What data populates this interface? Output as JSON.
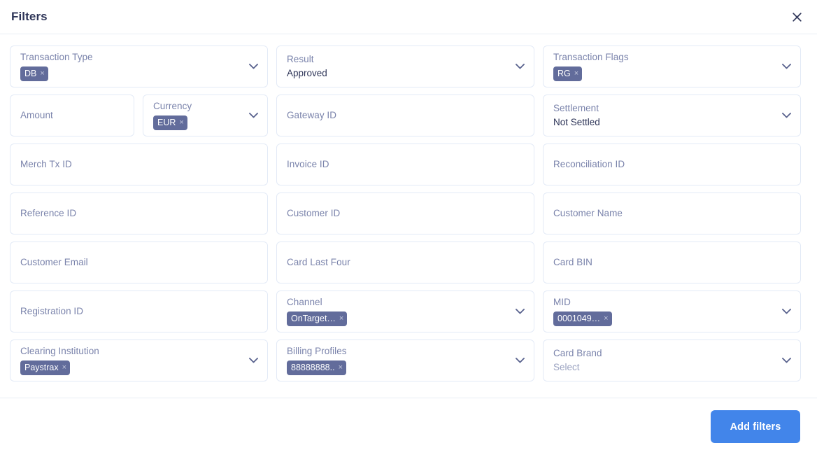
{
  "header": {
    "title": "Filters",
    "close_icon": "close-icon"
  },
  "icons": {
    "chevron": "chevron-down-icon",
    "chip_remove": "×"
  },
  "fields": [
    {
      "key": "transaction_type",
      "label": "Transaction Type",
      "type": "multiselect",
      "width": "full",
      "chips": [
        {
          "text": "DB"
        }
      ]
    },
    {
      "key": "result",
      "label": "Result",
      "type": "select",
      "width": "full",
      "value": "Approved"
    },
    {
      "key": "transaction_flags",
      "label": "Transaction Flags",
      "type": "multiselect",
      "width": "full",
      "chips": [
        {
          "text": "RG"
        }
      ]
    },
    {
      "key": "amount",
      "label": "Amount",
      "type": "text",
      "width": "narrow"
    },
    {
      "key": "currency",
      "label": "Currency",
      "type": "multiselect",
      "width": "narrow2",
      "chips": [
        {
          "text": "EUR"
        }
      ]
    },
    {
      "key": "gateway_id",
      "label": "Gateway ID",
      "type": "text",
      "width": "full"
    },
    {
      "key": "settlement",
      "label": "Settlement",
      "type": "select",
      "width": "full",
      "value": "Not Settled"
    },
    {
      "key": "merch_tx_id",
      "label": "Merch Tx ID",
      "type": "text",
      "width": "full"
    },
    {
      "key": "invoice_id",
      "label": "Invoice ID",
      "type": "text",
      "width": "full"
    },
    {
      "key": "reconciliation_id",
      "label": "Reconciliation ID",
      "type": "text",
      "width": "full"
    },
    {
      "key": "reference_id",
      "label": "Reference ID",
      "type": "text",
      "width": "full"
    },
    {
      "key": "customer_id",
      "label": "Customer ID",
      "type": "text",
      "width": "full"
    },
    {
      "key": "customer_name",
      "label": "Customer Name",
      "type": "text",
      "width": "full"
    },
    {
      "key": "customer_email",
      "label": "Customer Email",
      "type": "text",
      "width": "full"
    },
    {
      "key": "card_last_four",
      "label": "Card Last Four",
      "type": "text",
      "width": "full"
    },
    {
      "key": "card_bin",
      "label": "Card BIN",
      "type": "text",
      "width": "full"
    },
    {
      "key": "registration_id",
      "label": "Registration ID",
      "type": "text",
      "width": "full"
    },
    {
      "key": "channel",
      "label": "Channel",
      "type": "multiselect",
      "width": "full",
      "chips": [
        {
          "text": "OnTarget…"
        }
      ]
    },
    {
      "key": "mid",
      "label": "MID",
      "type": "multiselect",
      "width": "full",
      "chips": [
        {
          "text": "0001049…"
        }
      ]
    },
    {
      "key": "clearing_institution",
      "label": "Clearing Institution",
      "type": "multiselect",
      "width": "full",
      "chips": [
        {
          "text": "Paystrax"
        }
      ]
    },
    {
      "key": "billing_profiles",
      "label": "Billing Profiles",
      "type": "multiselect",
      "width": "full",
      "chips": [
        {
          "text": "88888888.."
        }
      ]
    },
    {
      "key": "card_brand",
      "label": "Card Brand",
      "type": "select",
      "width": "full",
      "value": "Select"
    }
  ],
  "footer": {
    "add_filters_label": "Add filters"
  },
  "colors": {
    "accent": "#4285ea",
    "chip_bg": "#626c9b",
    "label": "#7a83ab",
    "value": "#2e3558",
    "border": "#e3eaf6"
  }
}
